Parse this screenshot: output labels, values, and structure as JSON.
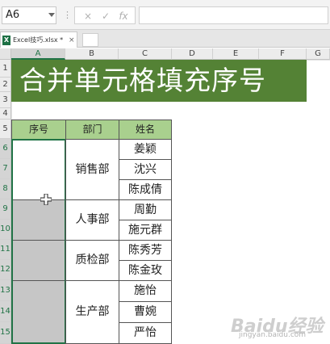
{
  "formula_bar": {
    "name_box": "A6",
    "cancel_icon": "×",
    "enter_icon": "✓",
    "fx_label": "fx",
    "formula": ""
  },
  "workbook_tab": {
    "label": "Excel技巧.xlsx *",
    "close": "×"
  },
  "columns": [
    "A",
    "B",
    "C",
    "D",
    "E",
    "F",
    "G"
  ],
  "rows": [
    "1",
    "2",
    "3",
    "4",
    "5",
    "6",
    "7",
    "8",
    "9",
    "10",
    "11",
    "12",
    "13",
    "14",
    "15"
  ],
  "title": "合并单元格填充序号",
  "table": {
    "headers": [
      "序号",
      "部门",
      "姓名"
    ],
    "departments": [
      "销售部",
      "人事部",
      "质检部",
      "生产部"
    ],
    "names": [
      "姜颖",
      "沈兴",
      "陈成倩",
      "周勤",
      "施元群",
      "陈秀芳",
      "陈金玫",
      "施怡",
      "曹婉",
      "严怡"
    ]
  },
  "watermark": {
    "text": "Baidu经验",
    "sub": "jingyan.baidu.com"
  },
  "colors": {
    "banner": "#548235",
    "header_fill": "#a9d08e",
    "merged_gray": "#c6c6c6",
    "select_green": "#217346"
  }
}
